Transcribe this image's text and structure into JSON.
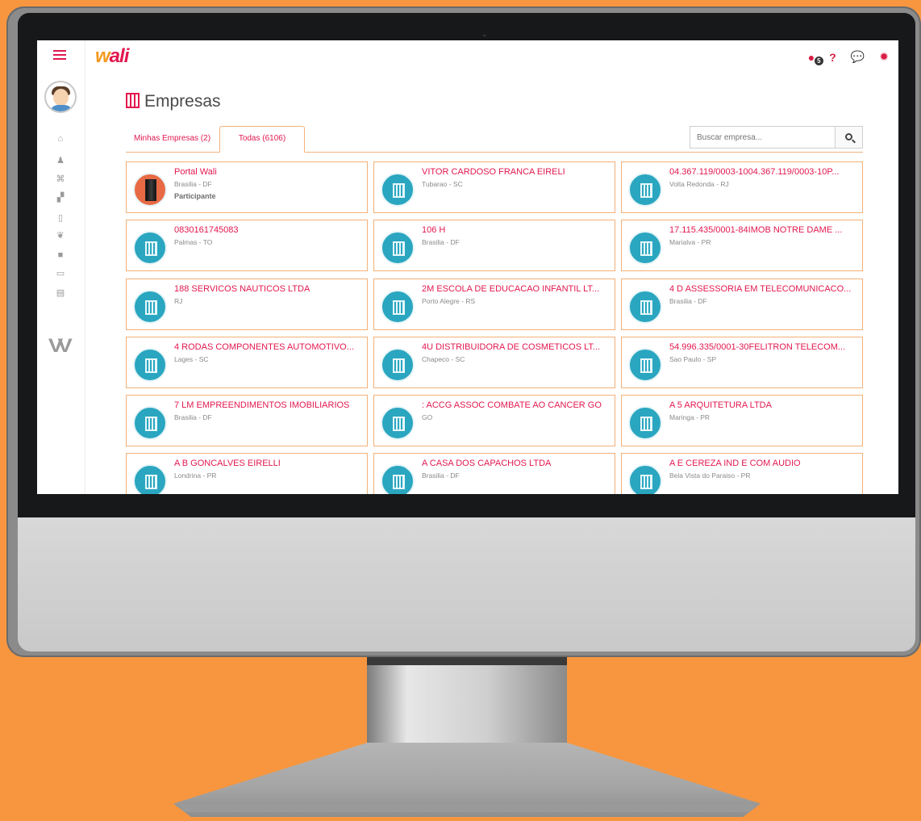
{
  "brand": {
    "name": "wali",
    "part1": "w",
    "part2": "ali"
  },
  "topbar": {
    "icons": [
      {
        "name": "globe-notifications-icon",
        "glyph": "●",
        "badge": "5"
      },
      {
        "name": "help-icon",
        "glyph": "?"
      },
      {
        "name": "chat-icon",
        "glyph": "💬"
      },
      {
        "name": "settings-icon",
        "glyph": "✹"
      }
    ]
  },
  "sidebar": {
    "items": [
      {
        "name": "home-icon",
        "glyph": "⌂"
      },
      {
        "name": "user-icon",
        "glyph": "♟"
      },
      {
        "name": "bank-icon",
        "glyph": "⌘"
      },
      {
        "name": "stairs-icon",
        "glyph": "▞"
      },
      {
        "name": "building-icon",
        "glyph": "▯"
      },
      {
        "name": "leaf-icon",
        "glyph": "❦"
      },
      {
        "name": "video-icon",
        "glyph": "■"
      },
      {
        "name": "card-icon",
        "glyph": "▭"
      },
      {
        "name": "document-icon",
        "glyph": "▤"
      }
    ]
  },
  "page": {
    "title": "Empresas"
  },
  "tabs": [
    {
      "label": "Minhas Empresas (2)"
    },
    {
      "label": "Todas (6106)"
    }
  ],
  "search": {
    "placeholder": "Buscar empresa..."
  },
  "companies": [
    {
      "name": "Portal Wali",
      "location": "Brasilia - DF",
      "tag": "Participante"
    },
    {
      "name": "VITOR CARDOSO FRANCA EIRELI",
      "location": "Tubarao - SC"
    },
    {
      "name": "04.367.119/0003-1004.367.119/0003-10P...",
      "location": "Volta Redonda - RJ"
    },
    {
      "name": "0830161745083",
      "location": "Palmas - TO"
    },
    {
      "name": "106 H",
      "location": "Brasilia - DF"
    },
    {
      "name": "17.115.435/0001-84IMOB NOTRE DAME ...",
      "location": "Marialva - PR"
    },
    {
      "name": "188 SERVICOS NAUTICOS LTDA",
      "location": "RJ"
    },
    {
      "name": "2M ESCOLA DE EDUCACAO INFANTIL LT...",
      "location": "Porto Alegre - RS"
    },
    {
      "name": "4 D ASSESSORIA EM TELECOMUNICACO...",
      "location": "Brasilia - DF"
    },
    {
      "name": "4 RODAS COMPONENTES AUTOMOTIVO...",
      "location": "Lages - SC"
    },
    {
      "name": "4U DISTRIBUIDORA DE COSMETICOS LT...",
      "location": "Chapeco - SC"
    },
    {
      "name": "54.996.335/0001-30FELITRON TELECOM...",
      "location": "Sao Paulo - SP"
    },
    {
      "name": "7 LM EMPREENDIMENTOS IMOBILIARIOS",
      "location": "Brasilia - DF"
    },
    {
      "name": ": ACCG ASSOC COMBATE AO CANCER GO",
      "location": "GO"
    },
    {
      "name": "A 5 ARQUITETURA LTDA",
      "location": "Maringa - PR"
    },
    {
      "name": "A B GONCALVES EIRELLI",
      "location": "Londrina - PR"
    },
    {
      "name": "A CASA DOS CAPACHOS LTDA",
      "location": "Brasilia - DF"
    },
    {
      "name": "A E CEREZA IND E COM AUDIO",
      "location": "Bela Vista do Paraiso - PR"
    }
  ],
  "colors": {
    "accent": "#e2184f",
    "brand_orange": "#f39a1f",
    "background": "#F7963F",
    "card_border": "#f3b077",
    "icon_teal": "#2aa6c0"
  }
}
